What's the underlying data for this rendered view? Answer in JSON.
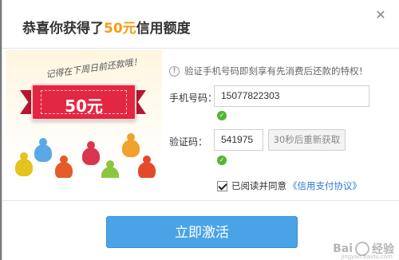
{
  "dialog": {
    "title_prefix": "恭喜你获得了",
    "title_amount": "50元",
    "title_suffix": "信用额度",
    "close_glyph": "✕"
  },
  "promo": {
    "caption": "记得在下周日前还款哦！",
    "ticket_amount": "50元"
  },
  "info": {
    "icon": "info-icon",
    "text": "验证手机号码即刻享有先消费后还款的特权！"
  },
  "form": {
    "phone_label": "手机号码：",
    "phone_value": "15077822303",
    "code_label": "验证码：",
    "code_value": "541975",
    "resend_label": "30秒后重新获取",
    "agree_text": "已阅读并同意",
    "agree_link": "《信用支付协议》"
  },
  "actions": {
    "activate_label": "立即激活"
  },
  "watermark": {
    "text": "Bai",
    "text2": "经验",
    "sub": "jingyan.baidu.com"
  },
  "colors": {
    "accent": "#f39c12",
    "primary_button": "#4aa3e7",
    "ticket": "#e32743",
    "success": "#55b531",
    "link": "#2a7ad2"
  }
}
